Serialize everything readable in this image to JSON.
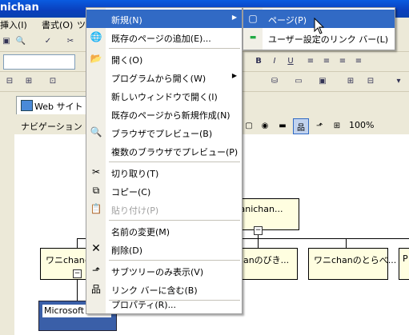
{
  "window": {
    "title": "nichan"
  },
  "menubar": {
    "insert": "挿入(I)",
    "format": "書式(O)",
    "tools": "ツ"
  },
  "tab": {
    "label": "Web サイト"
  },
  "navigation": {
    "header": "ナビゲーション",
    "zoom": "100%"
  },
  "nodes": {
    "root": ".wanichan...",
    "child1": "ワニchanの...",
    "child2": "hanのびき...",
    "child3": "ワニchanのとらべ...",
    "child4": "P",
    "selected": "Microsoft"
  },
  "context_menu": {
    "items": [
      {
        "label": "新規(N)",
        "icon": "",
        "submenu": true,
        "highlighted": true
      },
      {
        "label": "既存のページの追加(E)...",
        "icon": "add-existing-page-icon"
      },
      {
        "label": "開く(O)",
        "icon": "open-folder-icon"
      },
      {
        "label": "プログラムから開く(W)",
        "icon": "",
        "submenu": true
      },
      {
        "label": "新しいウィンドウで開く(I)",
        "icon": ""
      },
      {
        "label": "既存のページから新規作成(N)",
        "icon": ""
      },
      {
        "label": "ブラウザでプレビュー(B)",
        "icon": "preview-icon"
      },
      {
        "label": "複数のブラウザでプレビュー(P)",
        "icon": ""
      },
      {
        "label": "切り取り(T)",
        "icon": "scissors-icon"
      },
      {
        "label": "コピー(C)",
        "icon": "copy-icon"
      },
      {
        "label": "貼り付け(P)",
        "icon": "paste-icon",
        "disabled": true
      },
      {
        "label": "名前の変更(M)",
        "icon": ""
      },
      {
        "label": "削除(D)",
        "icon": "delete-x-icon"
      },
      {
        "label": "サブツリーのみ表示(V)",
        "icon": "subtree-icon"
      },
      {
        "label": "リンク バーに含む(B)",
        "icon": "link-bar-icon"
      },
      {
        "label": "プロパティ(R)...",
        "icon": ""
      }
    ]
  },
  "submenu": {
    "items": [
      {
        "label": "ページ(P)",
        "icon": "page-icon",
        "highlighted": true
      },
      {
        "label": "ユーザー設定のリンク バー(L)",
        "icon": "link-bar-icon"
      }
    ]
  },
  "colors": {
    "highlight": "#316ac5",
    "titlebar": "#0a3fbc",
    "node_fill": "#fffee0"
  }
}
